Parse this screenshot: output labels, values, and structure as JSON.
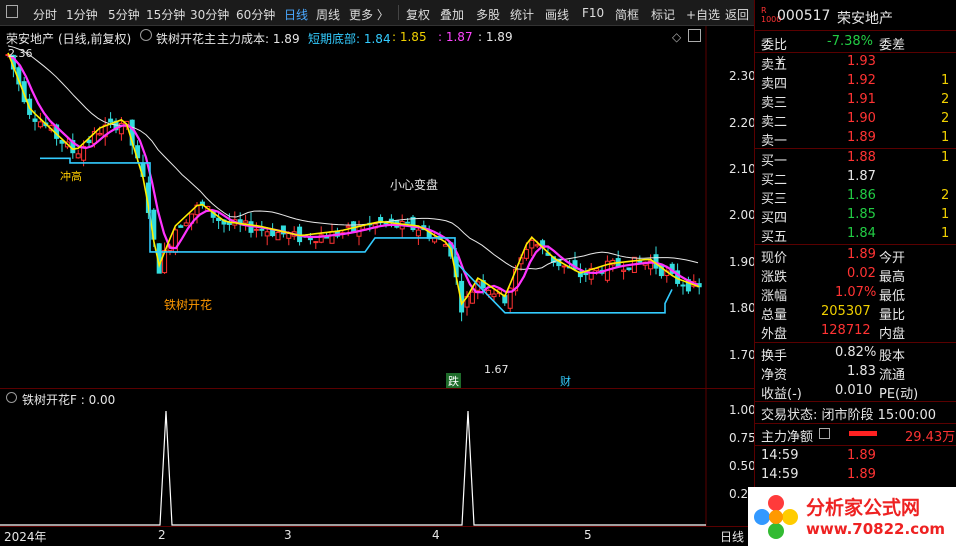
{
  "toolbar": {
    "items": [
      "分时",
      "1分钟",
      "5分钟",
      "15分钟",
      "30分钟",
      "60分钟",
      "日线",
      "周线",
      "更多 〉",
      "复权",
      "叠加",
      "多股",
      "统计",
      "画线",
      "F10",
      "简框",
      "标记",
      "+自选",
      "返回"
    ],
    "active": "日线"
  },
  "main": {
    "stock_label": "荣安地产",
    "mode_label": "(日线,前复权)",
    "indicator_name": "铁树开花主",
    "cost_label": "主力成本: 1.89",
    "short_label": "短期底部: 1.84",
    "short_v2": ": 1.85",
    "short_v3": ": 1.87",
    "short_v4": ": 1.89",
    "high_label": "2.36",
    "low_label": "1.67",
    "note_top": "小心变盘",
    "note_bottom": "铁树开花",
    "note_left": "冲高",
    "tag_die": "跌",
    "tag_cai": "财",
    "y_ticks": [
      "2.30",
      "2.20",
      "2.10",
      "2.00",
      "1.90",
      "1.80",
      "1.70"
    ]
  },
  "indicator": {
    "label": "铁树开花F : 0.00",
    "y_ticks": [
      "1.00",
      "0.75",
      "0.50",
      "0.25"
    ]
  },
  "date_axis": {
    "labels": [
      "2024年",
      "2",
      "3",
      "4",
      "5"
    ],
    "period": "日线"
  },
  "quote": {
    "code": "000517",
    "name": "荣安地产",
    "weibi_label": "委比",
    "weibi_value": "-7.38%",
    "weicha_label": "委差",
    "asks": [
      {
        "label": "卖五",
        "price": "1.93",
        "vol": ""
      },
      {
        "label": "卖四",
        "price": "1.92",
        "vol": "1"
      },
      {
        "label": "卖三",
        "price": "1.91",
        "vol": "2"
      },
      {
        "label": "卖二",
        "price": "1.90",
        "vol": "2"
      },
      {
        "label": "卖一",
        "price": "1.89",
        "vol": "1"
      }
    ],
    "bids": [
      {
        "label": "买一",
        "price": "1.88",
        "vol": "1"
      },
      {
        "label": "买二",
        "price": "1.87",
        "vol": ""
      },
      {
        "label": "买三",
        "price": "1.86",
        "vol": "2"
      },
      {
        "label": "买四",
        "price": "1.85",
        "vol": "1"
      },
      {
        "label": "买五",
        "price": "1.84",
        "vol": "1"
      }
    ],
    "stats": [
      {
        "l1": "现价",
        "v1": "1.89",
        "l2": "今开"
      },
      {
        "l1": "涨跌",
        "v1": "0.02",
        "l2": "最高"
      },
      {
        "l1": "涨幅",
        "v1": "1.07%",
        "l2": "最低"
      },
      {
        "l1": "总量",
        "v1": "205307",
        "l2": "量比"
      },
      {
        "l1": "外盘",
        "v1": "128712",
        "l2": "内盘"
      }
    ],
    "stats2": [
      {
        "l1": "换手",
        "v1": "0.82%",
        "l2": "股本"
      },
      {
        "l1": "净资",
        "v1": "1.83",
        "l2": "流通"
      },
      {
        "l1": "收益(-)",
        "v1": "0.010",
        "l2": "PE(动)"
      }
    ],
    "trade_status": "交易状态: 闭市阶段 15:00:00",
    "net_label": "主力净额",
    "net_value": "29.43万",
    "ticks": [
      {
        "time": "14:59",
        "price": "1.89"
      },
      {
        "time": "14:59",
        "price": "1.89"
      }
    ]
  },
  "watermark": {
    "title": "分析家公式网",
    "url": "www.70822.com"
  }
}
